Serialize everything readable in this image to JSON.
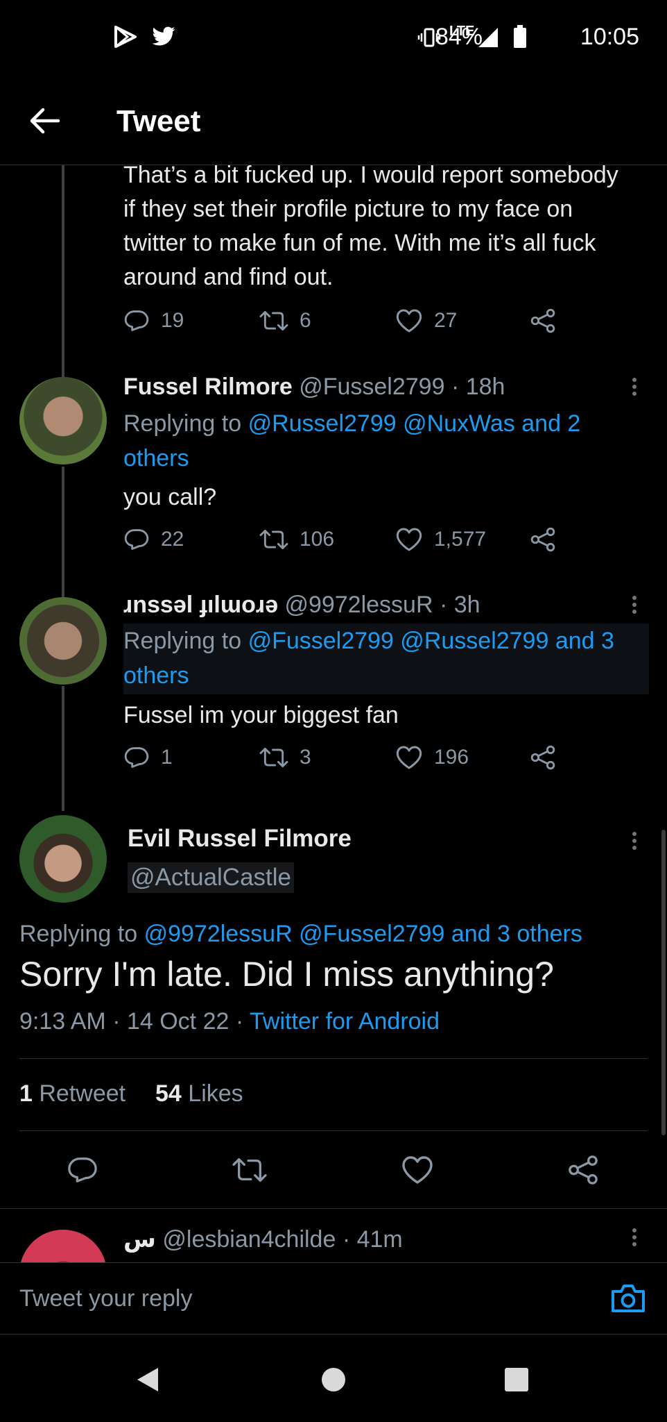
{
  "status_bar": {
    "network": "LTE",
    "battery": "84%",
    "time": "10:05"
  },
  "header": {
    "title": "Tweet"
  },
  "tweets": [
    {
      "text": "That’s a bit fucked up. I would report somebody if they set their profile picture to my face on twitter to make fun of me. With me it’s all fuck around and find out.",
      "replies": "19",
      "retweets": "6",
      "likes": "27"
    },
    {
      "name": "Fussel Rilmore",
      "handle": "@Fussel2799",
      "time": "· 18h",
      "replying_prefix": "Replying to",
      "replying_targets": "@Russel2799 @NuxWas and 2 others",
      "text": "you call?",
      "replies": "22",
      "retweets": "106",
      "likes": "1,577"
    },
    {
      "name": "ɹnssǝl ɟılɯoɹǝ",
      "handle": "@9972lessuR",
      "time": "· 3h",
      "replying_prefix": "Replying to",
      "replying_targets": "@Fussel2799 @Russel2799 and 3 others",
      "text": "Fussel im your biggest fan",
      "replies": "1",
      "retweets": "3",
      "likes": "196"
    }
  ],
  "main_tweet": {
    "name": "Evil Russel Filmore",
    "handle": "@ActualCastle",
    "replying_prefix": "Replying to",
    "replying_targets": "@9972lessuR @Fussel2799 and 3 others",
    "text": "Sorry I'm late. Did I miss anything?",
    "timestamp": "9:13 AM · 14 Oct 22 ·",
    "client": "Twitter for Android",
    "retweet_count": "1",
    "retweet_label": "Retweet",
    "like_count": "54",
    "like_label": "Likes"
  },
  "next_reply": {
    "name": "س",
    "handle": "@lesbian4childe",
    "time": "· 41m"
  },
  "reply_bar": {
    "placeholder": "Tweet your reply"
  },
  "colors": {
    "accent": "#1d9bf0",
    "muted": "#8b98a5",
    "background": "#000000"
  }
}
